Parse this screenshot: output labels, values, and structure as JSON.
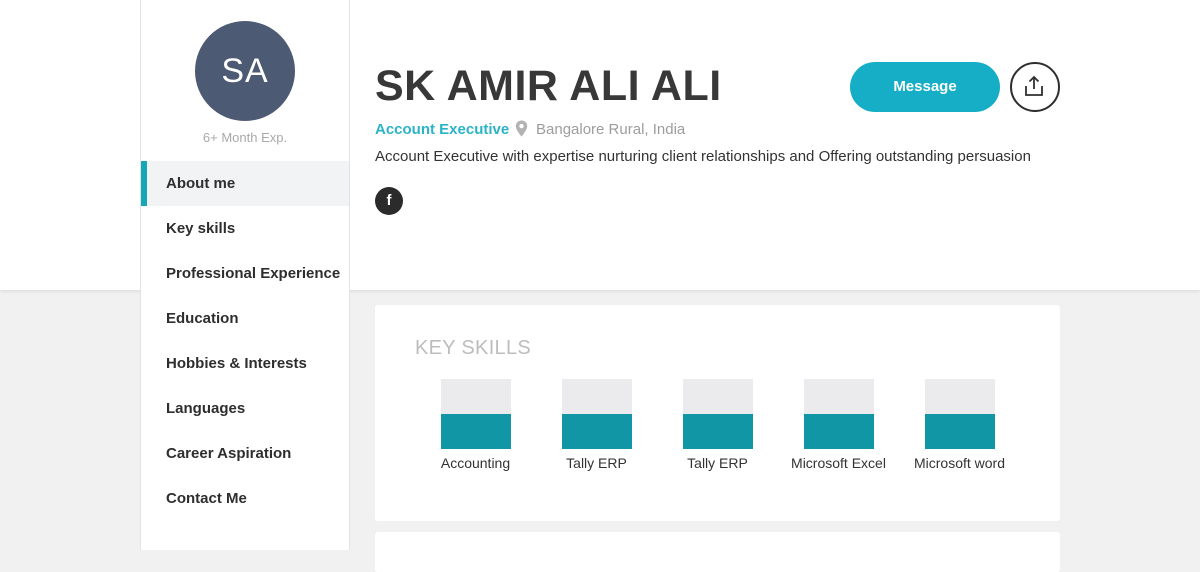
{
  "profile": {
    "initials": "SA",
    "experience": "6+ Month Exp.",
    "name": "SK AMIR ALI ALI",
    "role": "Account Executive",
    "location": "Bangalore Rural, India",
    "tagline": "Account Executive with expertise nurturing client relationships and Offering outstanding persuasion",
    "social_facebook": "f"
  },
  "actions": {
    "message_label": "Message"
  },
  "nav": {
    "items": [
      {
        "label": "About me",
        "active": true
      },
      {
        "label": "Key skills",
        "active": false
      },
      {
        "label": "Professional Experience",
        "active": false
      },
      {
        "label": "Education",
        "active": false
      },
      {
        "label": "Hobbies & Interests",
        "active": false
      },
      {
        "label": "Languages",
        "active": false
      },
      {
        "label": "Career Aspiration",
        "active": false
      },
      {
        "label": "Contact Me",
        "active": false
      }
    ]
  },
  "key_skills": {
    "title": "KEY SKILLS",
    "items": [
      {
        "name": "Accounting",
        "level": 0.5
      },
      {
        "name": "Tally ERP",
        "level": 0.5
      },
      {
        "name": "Tally ERP",
        "level": 0.5
      },
      {
        "name": "Microsoft Excel",
        "level": 0.5
      },
      {
        "name": "Microsoft word",
        "level": 0.5
      }
    ]
  },
  "colors": {
    "accent": "#16aec6",
    "skill_fill": "#1196a6",
    "avatar_bg": "#4d5a74"
  },
  "icons": {
    "location": "map-pin-icon",
    "share": "share-upload-icon",
    "facebook": "facebook-icon"
  }
}
